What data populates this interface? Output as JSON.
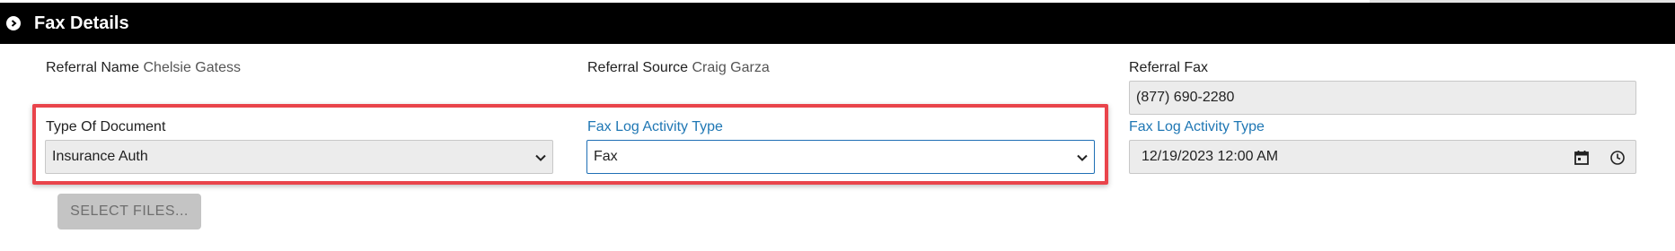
{
  "header": {
    "title": "Fax Details"
  },
  "referral": {
    "name_label": "Referral Name",
    "name_value": "Chelsie Gatess",
    "source_label": "Referral Source",
    "source_value": "Craig Garza",
    "fax_label": "Referral Fax",
    "fax_value": "(877) 690-2280"
  },
  "document": {
    "type_label": "Type Of Document",
    "type_value": "Insurance Auth"
  },
  "activity": {
    "type_label": "Fax Log Activity Type",
    "type_value": "Fax"
  },
  "datetime": {
    "label": "Fax Log Activity Type",
    "value": "12/19/2023 12:00 AM"
  },
  "actions": {
    "select_files_label": "SELECT FILES..."
  },
  "icons": {
    "header_toggle": "chevron-circle-right-icon",
    "dropdown": "chevron-down-icon",
    "calendar": "calendar-icon",
    "clock": "clock-icon"
  },
  "colors": {
    "header_bg": "#000000",
    "highlight_border": "#e9444b",
    "label_blue": "#1f77b4",
    "focus_border": "#1f6fb5"
  }
}
